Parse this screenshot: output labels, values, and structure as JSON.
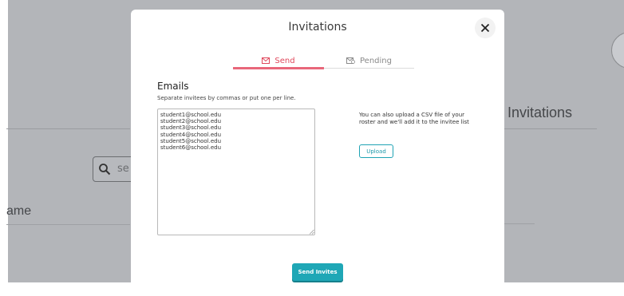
{
  "background": {
    "heading": "Invitations",
    "column_header": "ame",
    "search_placeholder": "se"
  },
  "modal": {
    "title": "Invitations",
    "tabs": [
      {
        "label": "Send",
        "active": true,
        "icon": "envelope-icon"
      },
      {
        "label": "Pending",
        "active": false,
        "icon": "envelope-clock-icon"
      }
    ],
    "emails_heading": "Emails",
    "emails_hint": "Separate invitees by commas or put one per line.",
    "emails_value": "student1@school.edu\nstudent2@school.edu\nstudent3@school.edu\nstudent4@school.edu\nstudent5@school.edu\nstudent6@school.edu",
    "csv_text": "You can also upload a CSV file of your roster and we'll add it to the invitee list",
    "upload_label": "Upload",
    "send_label": "Send Invites"
  },
  "colors": {
    "accent_teal": "#1fa7b6",
    "active_tab_red": "#e0485c",
    "overlay": "#b3b5b9"
  }
}
